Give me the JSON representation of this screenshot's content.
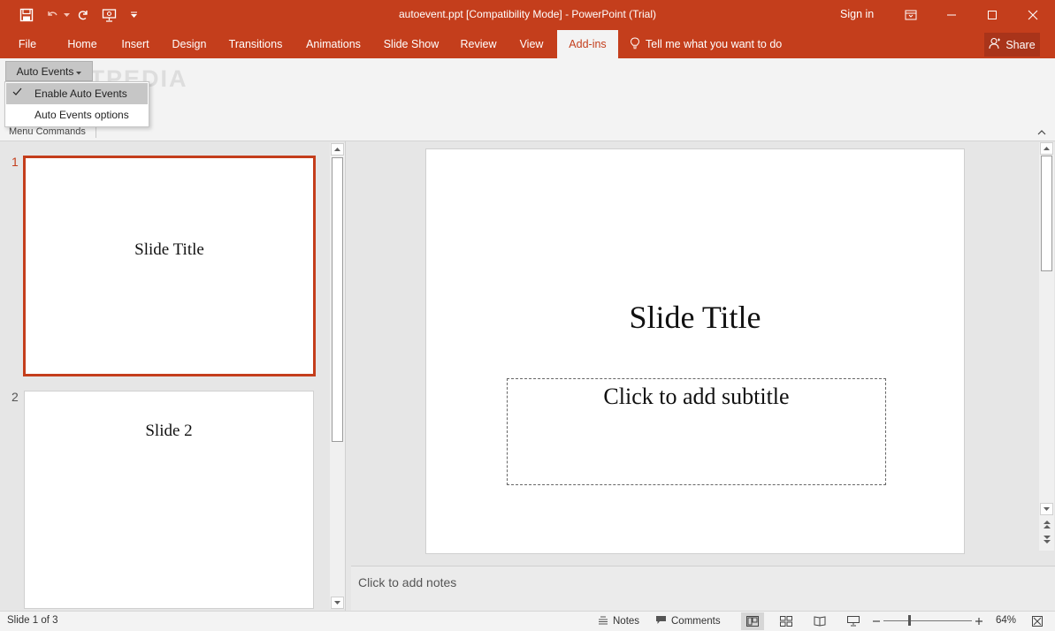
{
  "window": {
    "title": "autoevent.ppt [Compatibility Mode] - PowerPoint (Trial)",
    "sign_in": "Sign in",
    "qat_icons": [
      "save-icon",
      "undo-icon",
      "redo-icon",
      "start-from-beginning-icon",
      "customize-qat-icon"
    ],
    "window_icons": [
      "ribbon-display-options-icon",
      "minimize-icon",
      "maximize-icon",
      "close-icon"
    ]
  },
  "tabs": [
    {
      "label": "File"
    },
    {
      "label": "Home"
    },
    {
      "label": "Insert"
    },
    {
      "label": "Design"
    },
    {
      "label": "Transitions"
    },
    {
      "label": "Animations"
    },
    {
      "label": "Slide Show"
    },
    {
      "label": "Review"
    },
    {
      "label": "View"
    },
    {
      "label": "Add-ins",
      "active": true
    }
  ],
  "tell_me": "Tell me what you want to do",
  "share": "Share",
  "ribbon": {
    "auto_events_button": "Auto Events",
    "group_label": "Menu Commands",
    "watermark": "SOFTPEDIA"
  },
  "dropdown": {
    "items": [
      {
        "label": "Enable Auto Events",
        "checked": true
      },
      {
        "label": "Auto Events options",
        "checked": false
      }
    ]
  },
  "thumbnails": [
    {
      "number": "1",
      "title": "Slide Title",
      "selected": true
    },
    {
      "number": "2",
      "title": "Slide 2",
      "selected": false
    }
  ],
  "slide": {
    "title": "Slide Title",
    "subtitle_placeholder": "Click to add subtitle"
  },
  "notes_placeholder": "Click to add notes",
  "status": {
    "slide_count": "Slide 1 of 3",
    "notes": "Notes",
    "comments": "Comments",
    "zoom": "64%",
    "zoom_level": 0.64
  },
  "colors": {
    "accent": "#c43e1c",
    "ribbon_bg": "#f3f3f3",
    "workspace_bg": "#e6e6e6"
  }
}
